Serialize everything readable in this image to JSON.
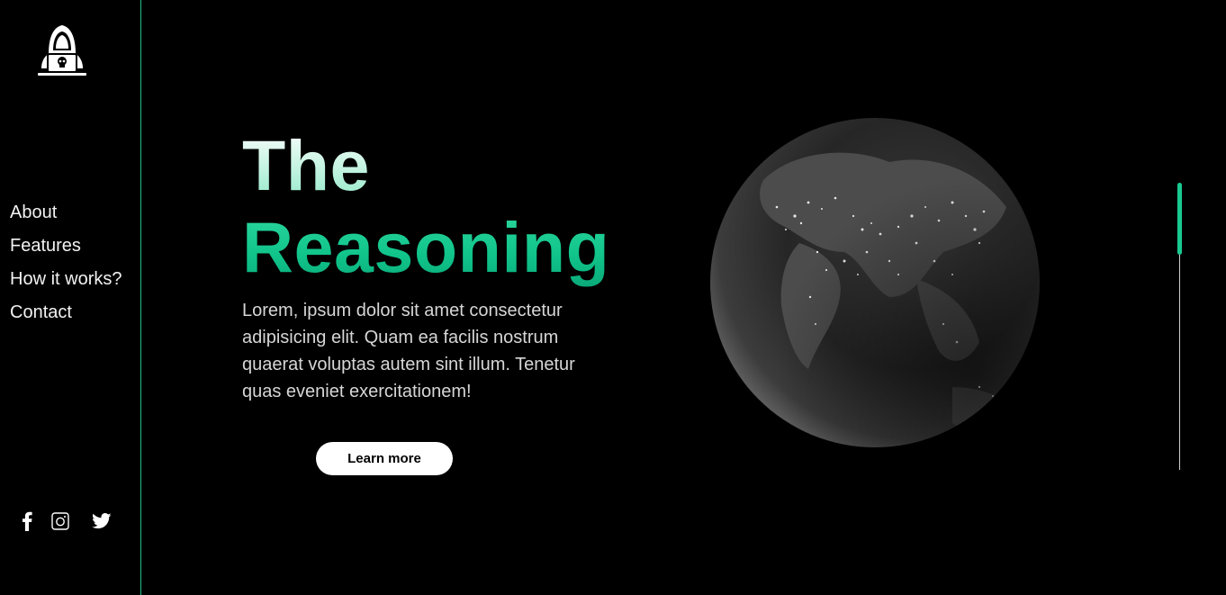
{
  "brand": {
    "logo_icon": "hacker-hoodie-laptop-icon"
  },
  "sidebar": {
    "nav": [
      {
        "label": "About"
      },
      {
        "label": "Features"
      },
      {
        "label": "How it works?"
      },
      {
        "label": "Contact"
      }
    ],
    "socials": [
      {
        "icon": "facebook-icon"
      },
      {
        "icon": "instagram-icon"
      },
      {
        "icon": "twitter-icon"
      }
    ]
  },
  "hero": {
    "title_line1": "The",
    "title_line2": "Reasoning",
    "description": "Lorem, ipsum dolor sit amet consectetur adipisicing elit. Quam ea facilis nostrum quaerat voluptas autem sint illum. Tenetur quas eveniet exercitationem!",
    "cta_label": "Learn more",
    "image_icon": "earth-at-night-globe"
  },
  "scroll_indicator": {
    "progress": 0.25
  },
  "colors": {
    "accent": "#1fbf8a",
    "background": "#000000",
    "button_bg": "#ffffff"
  }
}
